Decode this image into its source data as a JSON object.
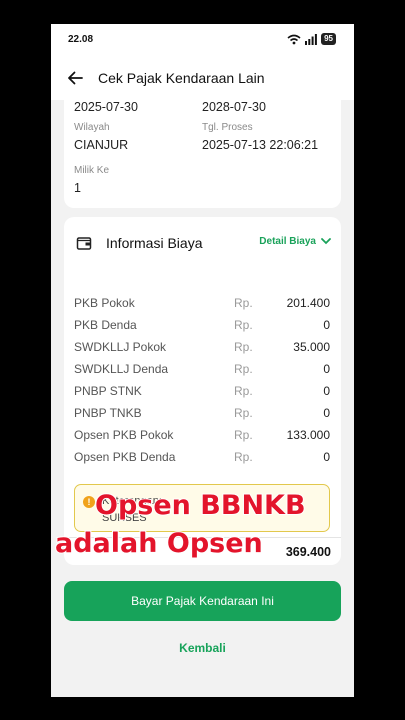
{
  "status_bar": {
    "time": "22.08",
    "battery": "95"
  },
  "app_bar": {
    "title": "Cek Pajak Kendaraan Lain"
  },
  "vehicle_info": {
    "dates": [
      "2025-07-30",
      "2028-07-30"
    ],
    "wilayah_label": "Wilayah",
    "wilayah_value": "CIANJUR",
    "tgl_proses_label": "Tgl. Proses",
    "tgl_proses_value": "2025-07-13 22:06:21",
    "milik_label": "Milik Ke",
    "milik_value": "1"
  },
  "biaya": {
    "title": "Informasi Biaya",
    "detail_label": "Detail Biaya",
    "currency": "Rp.",
    "rows": [
      {
        "name": "PKB Pokok",
        "amount": "201.400"
      },
      {
        "name": "PKB Denda",
        "amount": "0"
      },
      {
        "name": "SWDKLLJ Pokok",
        "amount": "35.000"
      },
      {
        "name": "SWDKLLJ Denda",
        "amount": "0"
      },
      {
        "name": "PNBP STNK",
        "amount": "0"
      },
      {
        "name": "PNBP TNKB",
        "amount": "0"
      },
      {
        "name": "Opsen PKB Pokok",
        "amount": "133.000"
      },
      {
        "name": "Opsen PKB Denda",
        "amount": "0"
      }
    ],
    "note_label": "Keterangan:",
    "note_value": "SUKSES",
    "total": "369.400"
  },
  "actions": {
    "pay_label": "Bayar Pajak Kendaraan Ini",
    "back_label": "Kembali"
  },
  "overlay_caption": {
    "line1": "Opsen BBNKB",
    "line2": "adalah Opsen"
  },
  "colors": {
    "accent": "#17a35a",
    "overlay_text": "#e3142b"
  }
}
